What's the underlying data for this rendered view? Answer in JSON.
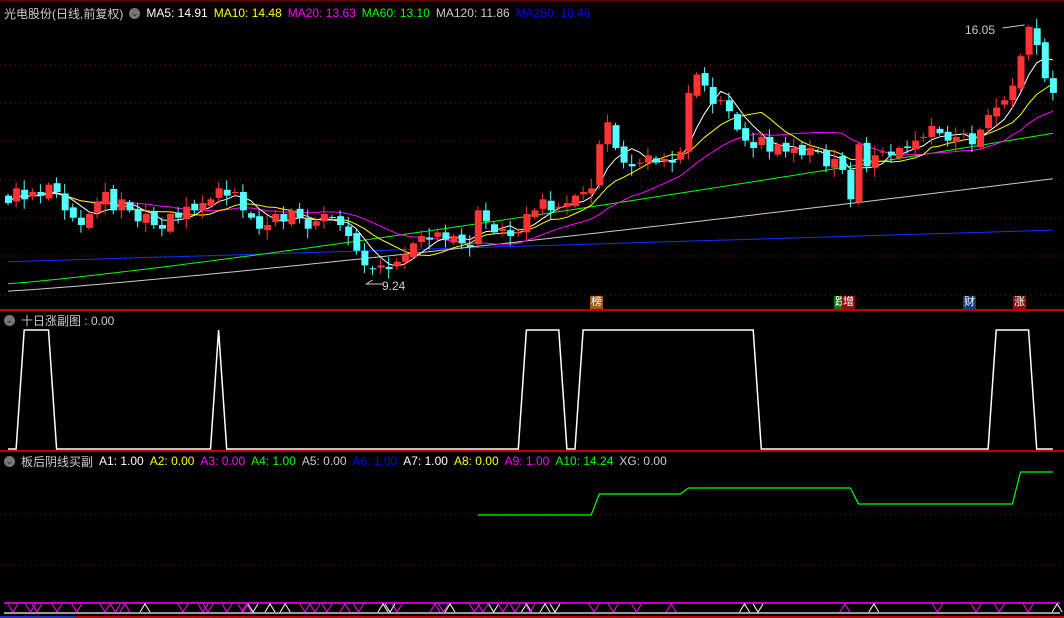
{
  "main": {
    "title": "光电股份(日线,前复权)",
    "ma_labels": [
      {
        "text": "MA5: 14.91",
        "color": "#ffffff"
      },
      {
        "text": "MA10: 14.48",
        "color": "#ffff00"
      },
      {
        "text": "MA20: 13.63",
        "color": "#ff00ff"
      },
      {
        "text": "MA60: 13.10",
        "color": "#00ff00"
      },
      {
        "text": "MA120: 11.86",
        "color": "#cccccc"
      },
      {
        "text": "MA250: 10.46",
        "color": "#0000ff"
      }
    ],
    "high_label": "16.05",
    "low_label": "9.24",
    "markers": [
      {
        "text": "榜",
        "bg": "#a0560a"
      },
      {
        "text": "跌",
        "bg": "#0a7a0a"
      },
      {
        "text": "增",
        "bg": "#8a0f0f"
      },
      {
        "text": "财",
        "bg": "#123c70"
      },
      {
        "text": "涨",
        "bg": "#8a0f0f"
      }
    ]
  },
  "panel2": {
    "title": "十日涨副图 : 0.00"
  },
  "panel3": {
    "title": "板后阴线买副",
    "labels": [
      {
        "text": "A1: 1.00",
        "color": "#ffffff"
      },
      {
        "text": "A2: 0.00",
        "color": "#ffff00"
      },
      {
        "text": "A3: 0.00",
        "color": "#ff00ff"
      },
      {
        "text": "A4: 1.00",
        "color": "#00ff00"
      },
      {
        "text": "A5: 0.00",
        "color": "#cccccc"
      },
      {
        "text": "A6: 1.00",
        "color": "#0000ff"
      },
      {
        "text": "A7: 1.00",
        "color": "#ffffff"
      },
      {
        "text": "A8: 0.00",
        "color": "#ffff00"
      },
      {
        "text": "A9: 1.00",
        "color": "#ff00ff"
      },
      {
        "text": "A10: 14.24",
        "color": "#00ff00"
      },
      {
        "text": "XG: 0.00",
        "color": "#cccccc"
      }
    ]
  },
  "chart_data": {
    "type": "candlestick",
    "close": [
      11.2,
      11.6,
      11.3,
      11.5,
      11.4,
      11.7,
      11.5,
      11.0,
      10.8,
      10.6,
      10.9,
      11.2,
      11.5,
      11.0,
      11.3,
      11.0,
      10.7,
      10.9,
      10.6,
      10.5,
      10.9,
      10.8,
      11.1,
      11.0,
      11.2,
      11.3,
      11.6,
      11.4,
      11.5,
      11.0,
      10.8,
      10.5,
      10.6,
      10.9,
      10.7,
      11.0,
      10.8,
      10.5,
      10.7,
      10.9,
      10.8,
      10.6,
      10.3,
      9.9,
      9.5,
      9.4,
      9.5,
      9.4,
      9.6,
      9.8,
      10.1,
      10.3,
      10.2,
      10.4,
      10.2,
      10.3,
      10.1,
      10.0,
      11.0,
      10.7,
      10.4,
      10.5,
      10.3,
      10.4,
      10.9,
      11.0,
      11.3,
      11.0,
      11.1,
      11.2,
      11.4,
      11.5,
      11.6,
      12.8,
      13.4,
      12.7,
      12.3,
      12.2,
      12.3,
      12.5,
      12.3,
      12.4,
      12.3,
      12.6,
      14.2,
      14.7,
      14.4,
      13.9,
      14.0,
      13.7,
      13.2,
      12.9,
      12.7,
      13.0,
      12.6,
      12.8,
      12.6,
      12.7,
      12.5,
      12.7,
      12.6,
      12.2,
      12.4,
      12.1,
      11.3,
      12.8,
      12.2,
      12.5,
      12.6,
      12.5,
      12.7,
      12.7,
      12.9,
      13.0,
      13.3,
      13.1,
      12.9,
      13.0,
      13.1,
      12.8,
      13.2,
      13.6,
      13.8,
      14.0,
      14.4,
      15.2,
      16.0,
      15.5,
      14.6,
      14.2
    ],
    "high_value": 16.05,
    "low_value": 9.24,
    "ma_long": {
      "MA60": [
        9.0,
        13.1
      ],
      "MA120": [
        8.8,
        11.86
      ],
      "MA250": [
        9.6,
        10.46
      ]
    },
    "panel2_signal_on_ranges": [
      [
        2,
        5
      ],
      [
        26,
        26
      ],
      [
        64,
        68
      ],
      [
        71,
        92
      ],
      [
        122,
        126
      ]
    ],
    "panel3_a10_steps": [
      [
        58,
        10.53
      ],
      [
        73,
        12.34
      ],
      [
        84,
        12.86
      ],
      [
        105,
        11.48
      ],
      [
        125,
        14.24
      ]
    ],
    "ylim": [
      9.24,
      16.05
    ]
  }
}
